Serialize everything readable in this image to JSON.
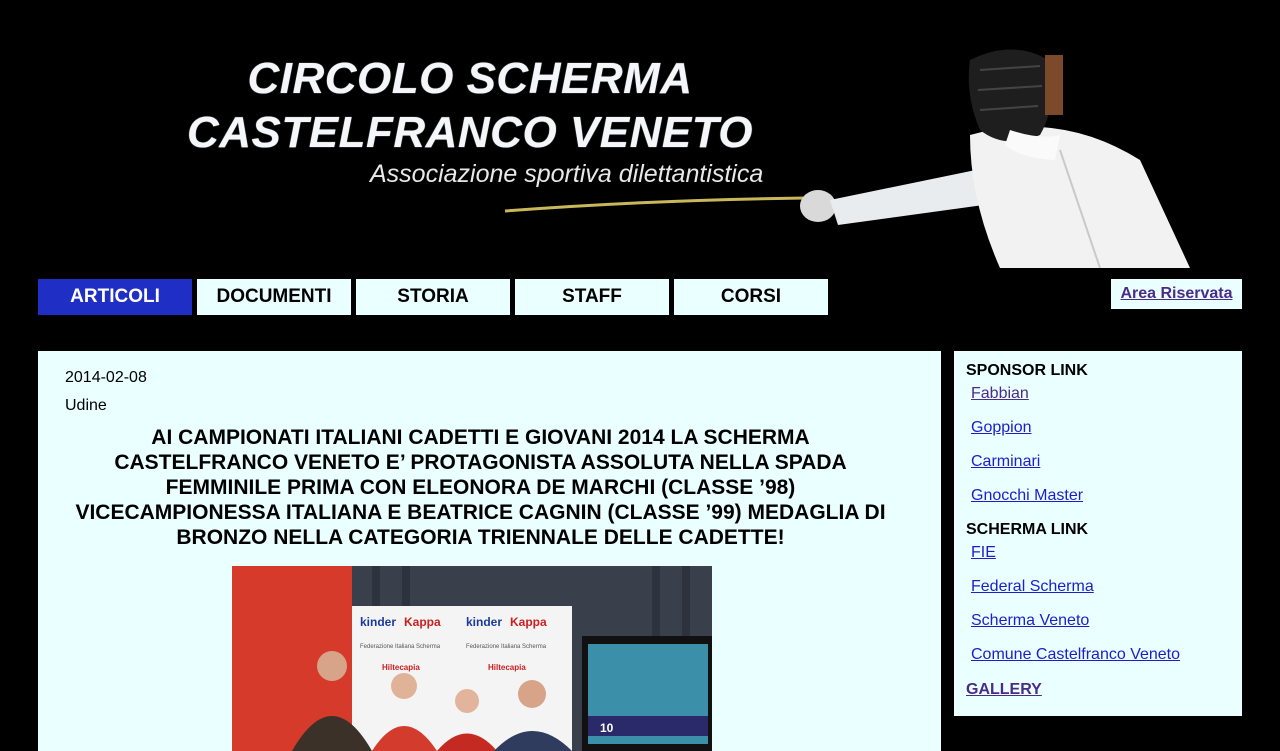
{
  "header": {
    "title_line1": "CIRCOLO SCHERMA",
    "title_line2": "CASTELFRANCO VENETO",
    "subtitle": "Associazione sportiva dilettantistica"
  },
  "nav": {
    "tabs": [
      {
        "label": "ARTICOLI",
        "active": true
      },
      {
        "label": "DOCUMENTI",
        "active": false
      },
      {
        "label": "STORIA",
        "active": false
      },
      {
        "label": "STAFF",
        "active": false
      },
      {
        "label": "CORSI",
        "active": false
      }
    ],
    "area_riservata": "Area Riservata"
  },
  "article": {
    "date": "2014-02-08",
    "place": "Udine",
    "title": "AI CAMPIONATI ITALIANI CADETTI E GIOVANI 2014 LA SCHERMA CASTELFRANCO VENETO E’ PROTAGONISTA ASSOLUTA NELLA SPADA FEMMINILE PRIMA CON ELEONORA DE MARCHI (CLASSE ’98) VICECAMPIONESSA ITALIANA E BEATRICE CAGNIN (CLASSE ’99) MEDAGLIA DI BRONZO NELLA CATEGORIA TRIENNALE DELLE CADETTE!",
    "photo_texts": [
      "kinder",
      "Kappa",
      "kinder",
      "Kappa",
      "Federazione Italiana Scherma",
      "Federazione Italiana Scherma",
      "Hiltecapia",
      "Hiltecapia",
      "10"
    ]
  },
  "sidebar": {
    "sponsor_heading": "SPONSOR LINK",
    "sponsor_links": [
      "Fabbian",
      "Goppion",
      "Carminari",
      "Gnocchi Master"
    ],
    "scherma_heading": "SCHERMA LINK",
    "scherma_links": [
      "FIE",
      "Federal Scherma",
      "Scherma Veneto",
      "Comune Castelfranco Veneto"
    ],
    "gallery": "GALLERY"
  },
  "colors": {
    "background": "#000000",
    "panel": "#eaffff",
    "active_tab": "#1f2ec4",
    "link": "#1d1dcc",
    "visited_link": "#4b2b8a"
  },
  "icons": [
    "fencer-illustration"
  ]
}
